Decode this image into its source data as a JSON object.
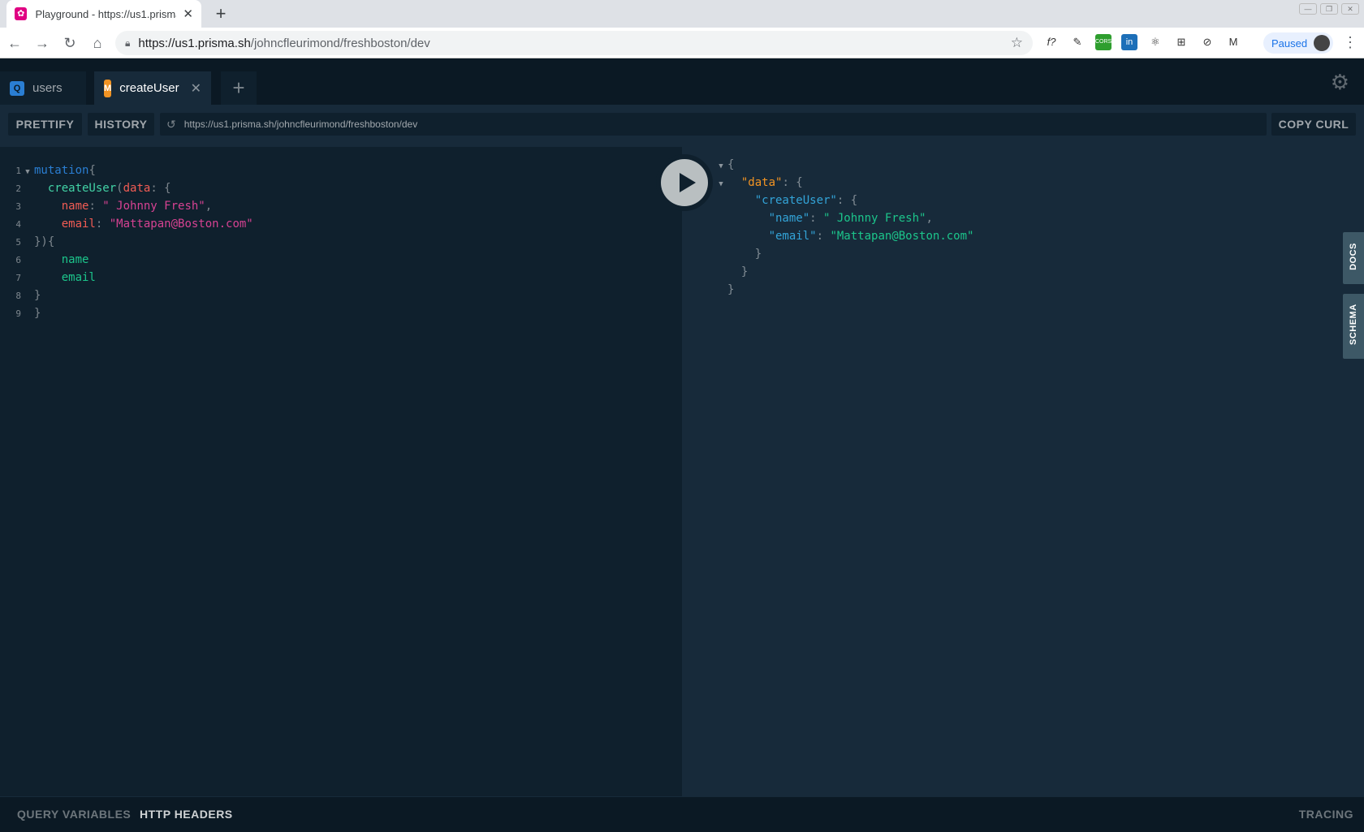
{
  "browser": {
    "tab_title": "Playground - https://us1.prisma",
    "url_host": "https://us1.prisma.sh",
    "url_path": "/johncfleurimond/freshboston/dev",
    "profile_status": "Paused"
  },
  "playground": {
    "tabs": [
      {
        "badge": "Q",
        "label": "users"
      },
      {
        "badge": "M",
        "label": "createUser"
      }
    ],
    "toolbar": {
      "prettify": "PRETTIFY",
      "history": "HISTORY",
      "endpoint": "https://us1.prisma.sh/johncfleurimond/freshboston/dev",
      "copy_curl": "COPY CURL"
    },
    "query": {
      "mutation_kw": "mutation",
      "op_name": "createUser",
      "arg": "data",
      "name_key": "name",
      "name_val": "\" Johnny Fresh\"",
      "email_key": "email",
      "email_val": "\"Mattapan@Boston.com\"",
      "field1": "name",
      "field2": "email"
    },
    "result": {
      "data_key": "\"data\"",
      "createUser_key": "\"createUser\"",
      "name_key": "\"name\"",
      "name_val": "\" Johnny Fresh\"",
      "email_key": "\"email\"",
      "email_val": "\"Mattapan@Boston.com\""
    },
    "side_tabs": {
      "docs": "DOCS",
      "schema": "SCHEMA"
    },
    "bottom": {
      "query_variables": "QUERY VARIABLES",
      "http_headers": "HTTP HEADERS",
      "tracing": "TRACING"
    }
  }
}
